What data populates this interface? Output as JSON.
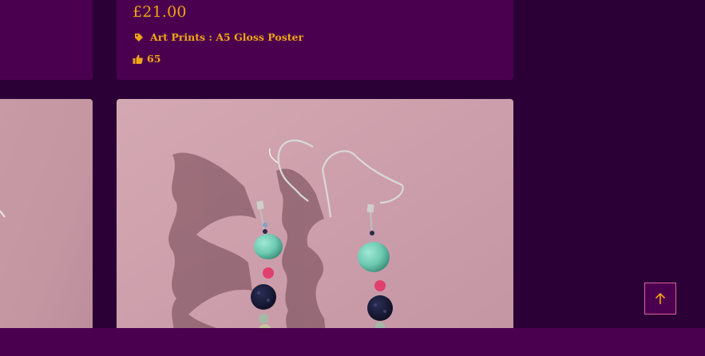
{
  "product": {
    "price": "£21.00",
    "category": "Art Prints : A5 Gloss Poster",
    "likes": "65"
  },
  "icons": {
    "category": "tag-icon",
    "likes": "thumbs-up-icon",
    "scroll_top": "arrow-up-icon"
  },
  "colors": {
    "background": "#2b0036",
    "card": "#4b004f",
    "accent": "#f0a614",
    "scroll_top_border": "#e0609a"
  }
}
